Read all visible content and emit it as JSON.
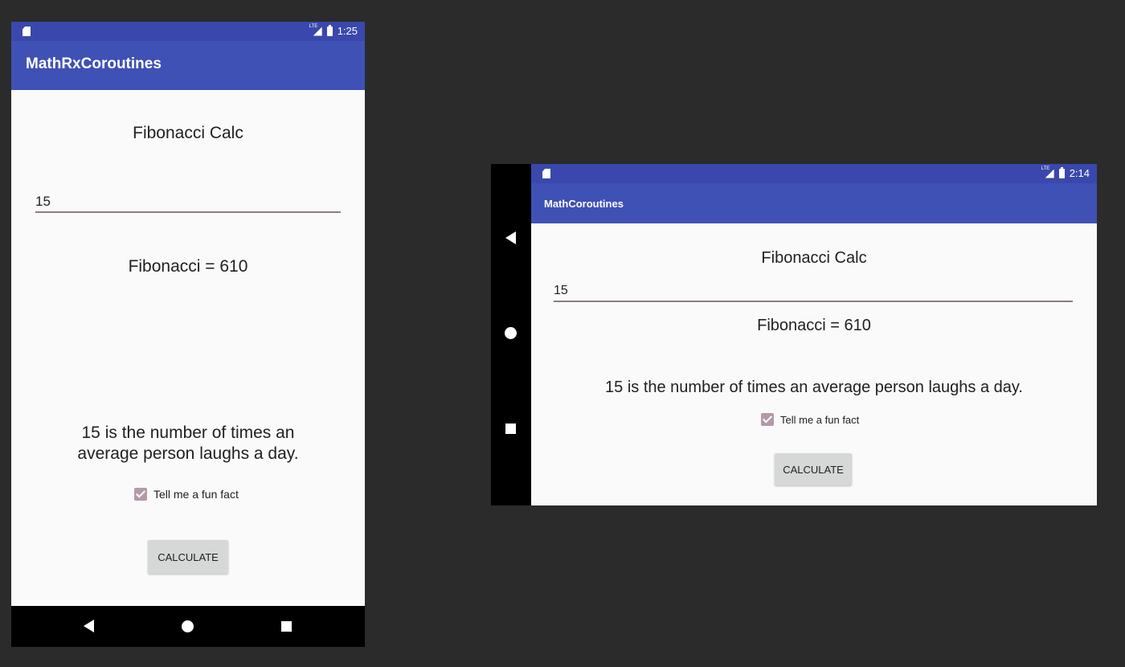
{
  "portrait": {
    "status_time": "1:25",
    "app_title": "MathRxCoroutines",
    "heading": "Fibonacci Calc",
    "input_value": "15",
    "result": "Fibonacci = 610",
    "fun_fact": "15 is the number of times an average person laughs a day.",
    "checkbox_label": "Tell me a fun fact",
    "checkbox_checked": true,
    "button_label": "CALCULATE"
  },
  "landscape": {
    "status_time": "2:14",
    "app_title": "MathCoroutines",
    "heading": "Fibonacci Calc",
    "input_value": "15",
    "result": "Fibonacci = 610",
    "fun_fact": "15 is the number of times an average person laughs a day.",
    "checkbox_label": "Tell me a fun fact",
    "checkbox_checked": true,
    "button_label": "CALCULATE"
  },
  "icons": {
    "sd_card": "sd-card-icon",
    "signal": "signal-icon",
    "battery": "battery-icon",
    "back": "back-icon",
    "home": "home-icon",
    "recents": "recents-icon"
  },
  "colors": {
    "primary": "#3f51b5",
    "primary_dark": "#3a48ad",
    "background": "#fafafa",
    "accent_checkbox": "#b39aa8",
    "button": "#d6d7d7"
  }
}
